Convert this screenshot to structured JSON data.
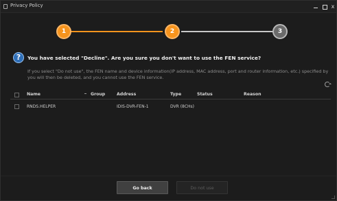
{
  "window": {
    "title": "Privacy Policy",
    "close_glyph": "x"
  },
  "stepper": {
    "steps": [
      "1",
      "2",
      "3"
    ],
    "current_step": 2,
    "colors": {
      "active": "#f7941d",
      "inactive": "#6a6a6a"
    }
  },
  "question": {
    "text": "You have selected \"Decline\". Are you sure you don't want to use the FEN service?",
    "icon": "question-icon"
  },
  "description": "If you select \"Do not use\", the FEN name and device information(IP address, MAC address, port and router information, etc.) specified by you will then be deleted, and you cannot use the FEN service.",
  "table": {
    "columns": [
      "Name",
      "Group",
      "Address",
      "Type",
      "Status",
      "Reason"
    ],
    "rows": [
      {
        "name": "RNDS.HELPER",
        "group": "",
        "address": "IDIS-DVR-FEN-1",
        "type": "DVR (8CHs)",
        "status": "",
        "reason": ""
      }
    ]
  },
  "buttons": {
    "go_back": "Go back",
    "do_not_use": "Do not use"
  }
}
